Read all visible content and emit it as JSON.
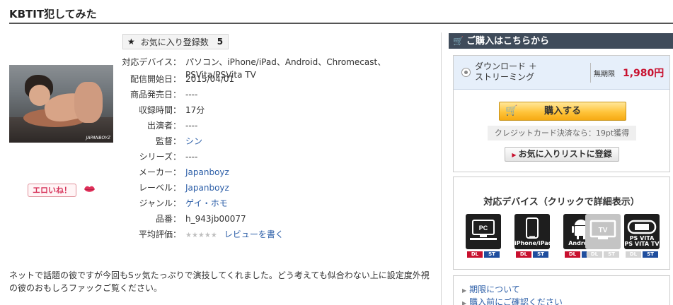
{
  "title": "KBTIT犯してみた",
  "thumbnail_watermark": "JAPANBOYZ",
  "erotic_button": "エロいね！",
  "favorite": {
    "label": "お気に入り登録数",
    "count": "5"
  },
  "info": [
    {
      "label": "対応デバイス：",
      "value": "パソコン、iPhone/iPad、Android、Chromecast、PSVita/PSVita TV"
    },
    {
      "label": "配信開始日：",
      "value": "2015/04/01"
    },
    {
      "label": "商品発売日：",
      "value": "----"
    },
    {
      "label": "収録時間：",
      "value": "17分"
    },
    {
      "label": "出演者：",
      "value": "----"
    },
    {
      "label": "監督：",
      "value": "シン"
    },
    {
      "label": "シリーズ：",
      "value": "----"
    },
    {
      "label": "メーカー：",
      "value": "Japanboyz"
    },
    {
      "label": "レーベル：",
      "value": "Japanboyz"
    },
    {
      "label": "ジャンル：",
      "value": "ゲイ・ホモ"
    },
    {
      "label": "品番：",
      "value": "h_943jb00077"
    },
    {
      "label": "平均評価：",
      "value": "★★★★★",
      "link": "レビューを書く"
    }
  ],
  "description": "ネットで話題の彼ですが今回もSッ気たっぷりで演技してくれました。どう考えても似合わない上に設定度外視の彼のおもしろファックご覧ください。",
  "purchase": {
    "header": "ご購入はこちらから",
    "option_label": "ダウンロード ＋ ストリーミング",
    "period": "無期限",
    "price": "1,980円",
    "buy_button": "購入する",
    "credit_note": "クレジットカード決済なら：19pt獲得",
    "fav_list_button": "お気に入りリストに登録"
  },
  "devices": {
    "title": "対応デバイス（クリックで詳細表示）",
    "items": [
      {
        "label": "PC",
        "sub": "",
        "dl": "DL",
        "st": "ST",
        "dl_on": true,
        "st_on": true
      },
      {
        "label": "",
        "sub": "iPhone/iPad",
        "dl": "DL",
        "st": "ST",
        "dl_on": true,
        "st_on": true
      },
      {
        "label": "",
        "sub": "Android",
        "dl": "DL",
        "st": "ST",
        "dl_on": true,
        "st_on": true
      },
      {
        "label": "TV",
        "sub": "",
        "dl": "DL",
        "st": "ST",
        "dl_on": false,
        "st_on": false
      },
      {
        "label": "",
        "sub": "PS VITA\nPS VITA TV",
        "dl": "DL",
        "st": "ST",
        "dl_on": false,
        "st_on": true
      }
    ]
  },
  "links": [
    "期限について",
    "購入前にご確認ください"
  ],
  "colors": {
    "price": "#c8102e",
    "link": "#2d5fa8",
    "header_bg": "#3f4b5a",
    "buy_button": "#ffc43a"
  }
}
